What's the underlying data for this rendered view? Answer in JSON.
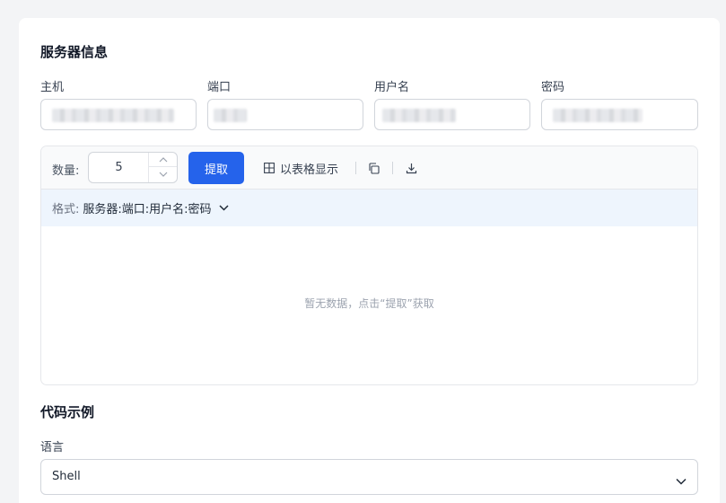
{
  "server": {
    "title": "服务器信息",
    "fields": [
      {
        "label": "主机",
        "value": ""
      },
      {
        "label": "端口",
        "value": ""
      },
      {
        "label": "用户名",
        "value": ""
      },
      {
        "label": "密码",
        "value": ""
      }
    ]
  },
  "toolbar": {
    "quantity_label": "数量:",
    "quantity_value": "5",
    "extract_label": "提取",
    "table_label": "以表格显示",
    "icons": [
      "table-icon",
      "copy-icon",
      "download-icon"
    ]
  },
  "format": {
    "label": "格式:",
    "value": "服务器:端口:用户名:密码"
  },
  "results": {
    "empty_text": "暂无数据，点击“提取”获取"
  },
  "code": {
    "title": "代码示例",
    "language_label": "语言",
    "language_value": "Shell"
  },
  "colors": {
    "accent": "#2563eb",
    "format_bar_bg": "#eef5fd",
    "page_bg": "#f3f4f6"
  }
}
